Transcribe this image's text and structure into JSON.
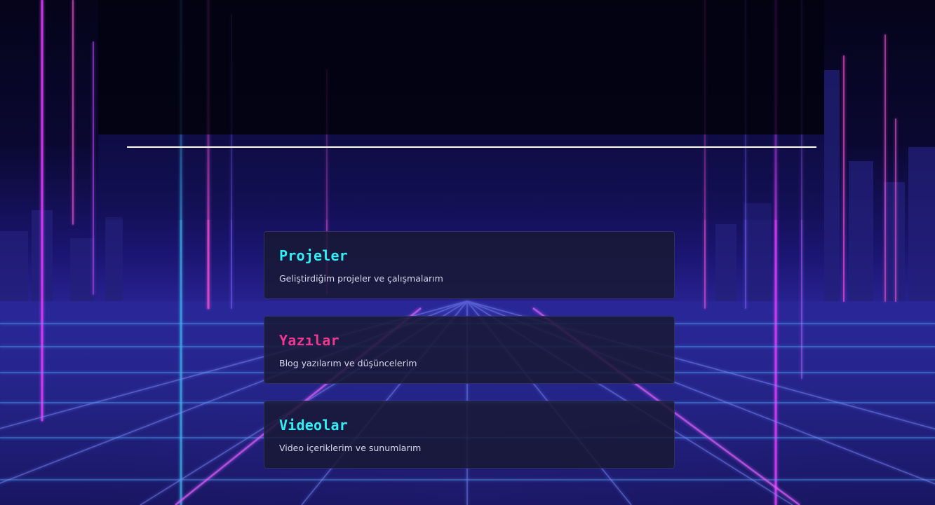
{
  "cards": [
    {
      "title": "Projeler",
      "description": "Geliştirdiğim projeler ve çalışmalarım",
      "title_color": "#2ef0f6"
    },
    {
      "title": "Yazılar",
      "description": "Blog yazılarım ve düşüncelerim",
      "title_color": "#f0388f"
    },
    {
      "title": "Videolar",
      "description": "Video içeriklerim ve sunumlarım",
      "title_color": "#2ef0f6"
    }
  ],
  "colors": {
    "background": "#05041a",
    "grid_neon_blue": "#3fd0ff",
    "grid_neon_pink": "#e040ff",
    "divider": "#ffffff"
  }
}
